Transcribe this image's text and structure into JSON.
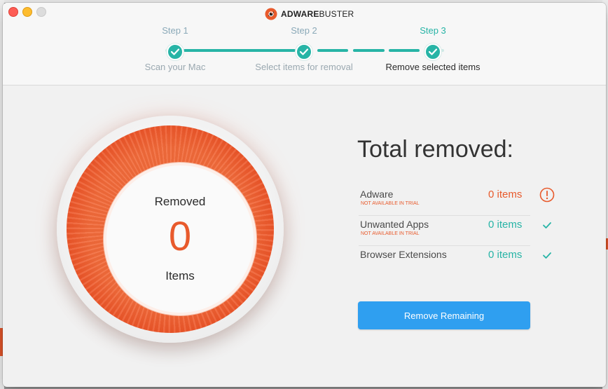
{
  "app": {
    "brand_bold": "ADWARE",
    "brand_light": "BUSTER"
  },
  "steps": [
    {
      "title": "Step 1",
      "subtitle": "Scan your Mac",
      "active": false
    },
    {
      "title": "Step 2",
      "subtitle": "Select items for removal",
      "active": false
    },
    {
      "title": "Step 3",
      "subtitle": "Remove selected items",
      "active": true
    }
  ],
  "gauge": {
    "label_top": "Removed",
    "count": "0",
    "label_bottom": "Items"
  },
  "summary": {
    "title": "Total removed:",
    "rows": [
      {
        "name": "Adware",
        "note": "NOT AVAILABLE IN TRIAL",
        "count": "0 items",
        "status": "warning-icon",
        "status_color": "#e85a2c"
      },
      {
        "name": "Unwanted Apps",
        "note": "NOT AVAILABLE IN TRIAL",
        "count": "0 items",
        "status": "check-icon",
        "status_color": "#27b4a6"
      },
      {
        "name": "Browser Extensions",
        "note": "",
        "count": "0 items",
        "status": "check-icon",
        "status_color": "#27b4a6"
      }
    ]
  },
  "actions": {
    "remove_remaining": "Remove Remaining"
  },
  "colors": {
    "accent_teal": "#27b4a6",
    "accent_orange": "#e85a2c",
    "button_blue": "#2f9ff0"
  }
}
